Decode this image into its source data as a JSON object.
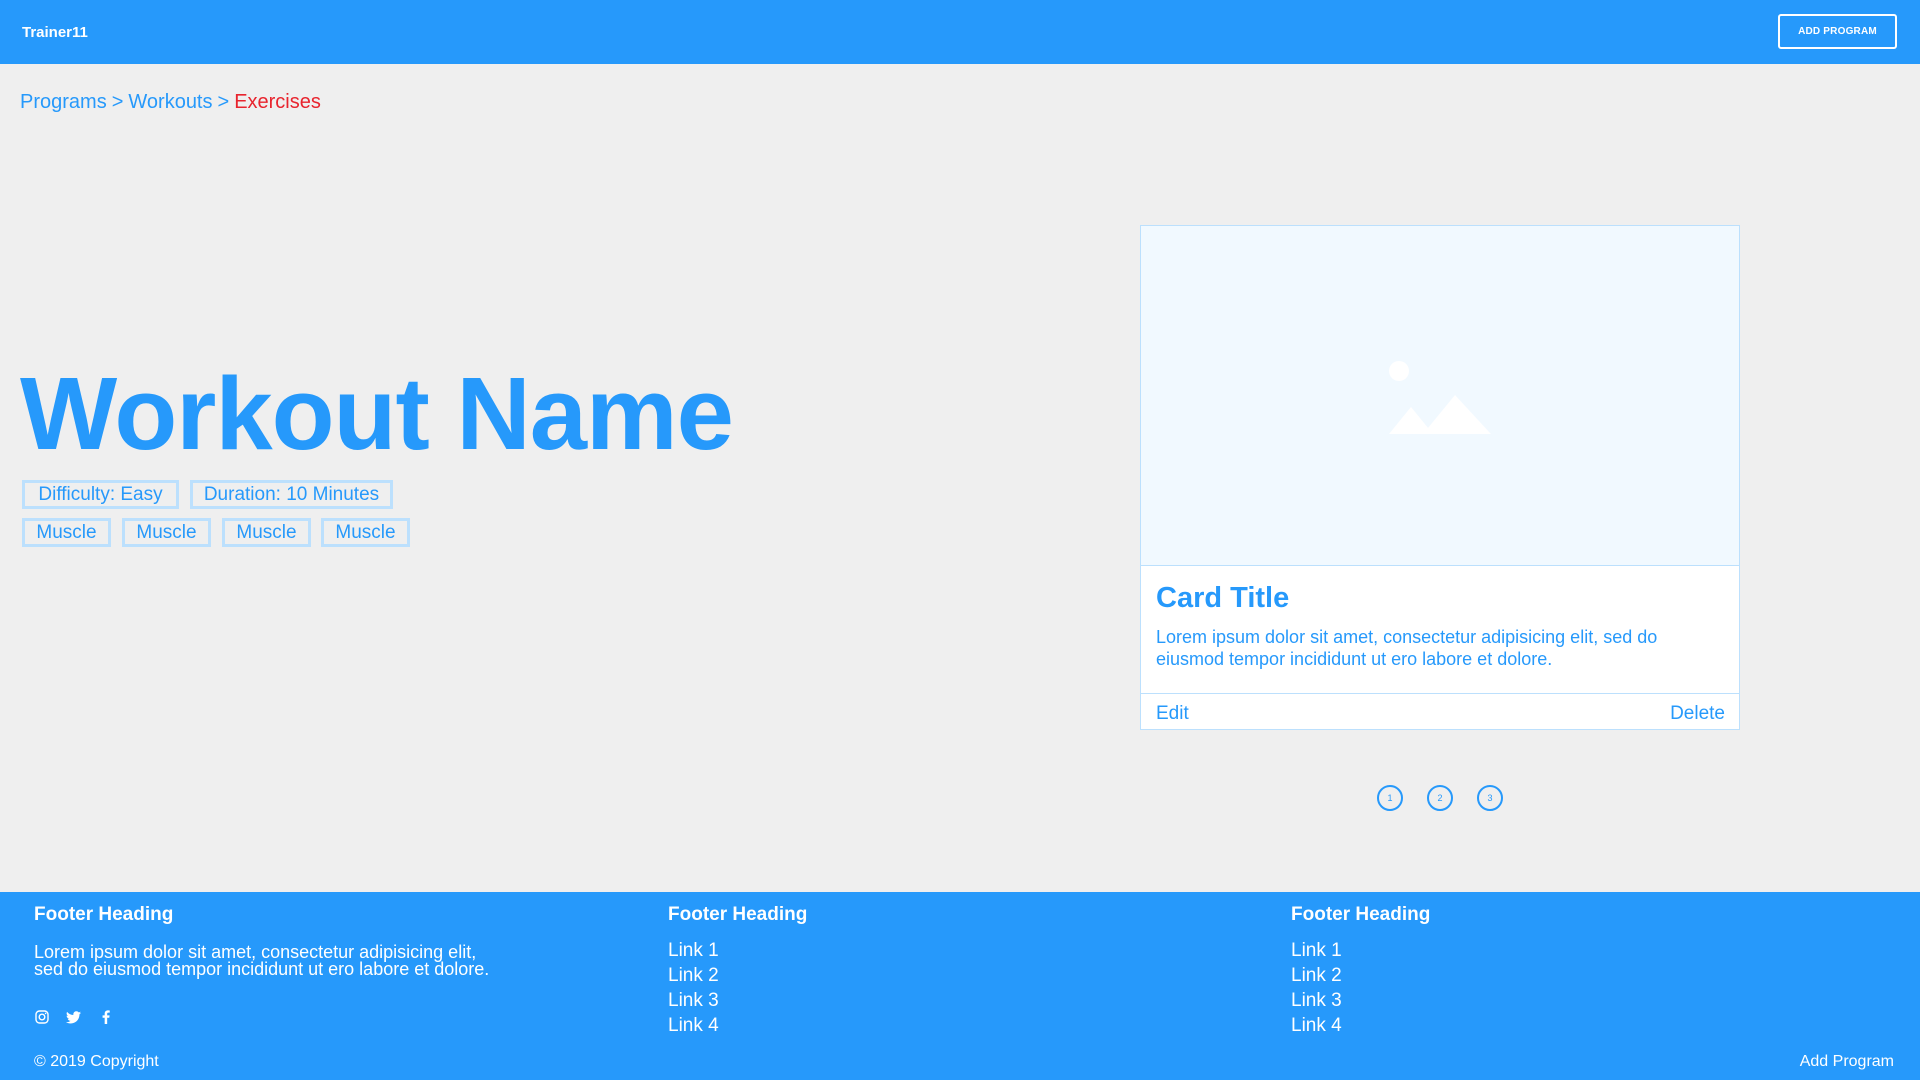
{
  "header": {
    "brand": "Trainer11",
    "add_program_label": "ADD PROGRAM"
  },
  "breadcrumb": {
    "items": [
      "Programs",
      "Workouts",
      "Exercises"
    ],
    "separator": ">"
  },
  "workout": {
    "name": "Workout Name",
    "difficulty": "Difficulty: Easy",
    "duration": "Duration: 10 Minutes",
    "muscles": [
      "Muscle",
      "Muscle",
      "Muscle",
      "Muscle"
    ]
  },
  "card": {
    "image_icon": "image-placeholder-icon",
    "title": "Card Title",
    "text": "Lorem ipsum dolor sit amet, consectetur adipisicing elit, sed do eiusmod tempor incididunt ut ero labore et dolore.",
    "edit_label": "Edit",
    "delete_label": "Delete"
  },
  "pagination": [
    "1",
    "2",
    "3"
  ],
  "footer": {
    "columns": [
      {
        "heading": "Footer Heading",
        "text": "Lorem ipsum dolor sit amet, consectetur adipisicing elit, sed do eiusmod tempor incididunt ut ero labore et dolore."
      },
      {
        "heading": "Footer Heading",
        "links": [
          "Link 1",
          "Link 2",
          "Link 3",
          "Link 4"
        ]
      },
      {
        "heading": "Footer Heading",
        "links": [
          "Link 1",
          "Link 2",
          "Link 3",
          "Link 4"
        ]
      }
    ],
    "social_icons": [
      "instagram-icon",
      "twitter-icon",
      "facebook-icon"
    ],
    "copyright": "© 2019 Copyright",
    "add_program_link": "Add Program"
  },
  "colors": {
    "primary": "#2699fb",
    "active_breadcrumb": "#e8242e",
    "tag_border": "#bce0fd",
    "background": "#efefef",
    "image_placeholder": "#f1f9ff"
  }
}
